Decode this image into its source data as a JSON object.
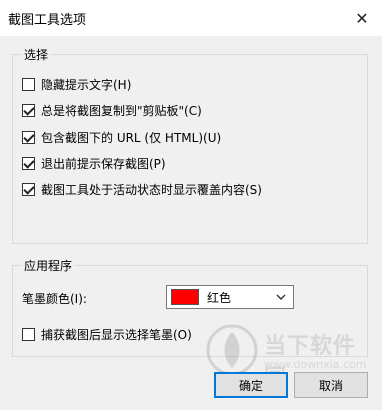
{
  "window": {
    "title": "截图工具选项",
    "close_glyph": "✕"
  },
  "options_group": {
    "label": "选择",
    "items": [
      {
        "label": "隐藏提示文字(H)",
        "checked": false
      },
      {
        "label": "总是将截图复制到\"剪贴板\"(C)",
        "checked": true
      },
      {
        "label": "包含截图下的 URL (仅 HTML)(U)",
        "checked": true
      },
      {
        "label": "退出前提示保存截图(P)",
        "checked": true
      },
      {
        "label": "截图工具处于活动状态时显示覆盖内容(S)",
        "checked": true
      }
    ]
  },
  "app_group": {
    "label": "应用程序",
    "ink_color_label": "笔墨颜色(I):",
    "ink_color": {
      "value": "红色",
      "swatch": "#ff0000"
    },
    "show_ink_label": "捕获截图后显示选择笔墨(O)",
    "show_ink_checked": false
  },
  "buttons": {
    "ok": "确定",
    "cancel": "取消"
  },
  "watermark": {
    "text": "当下软件园",
    "url": "www.downxia.com"
  },
  "colors": {
    "accent": "#0078d7",
    "background": "#f0f0f0",
    "group_border": "#d9d9d9"
  }
}
